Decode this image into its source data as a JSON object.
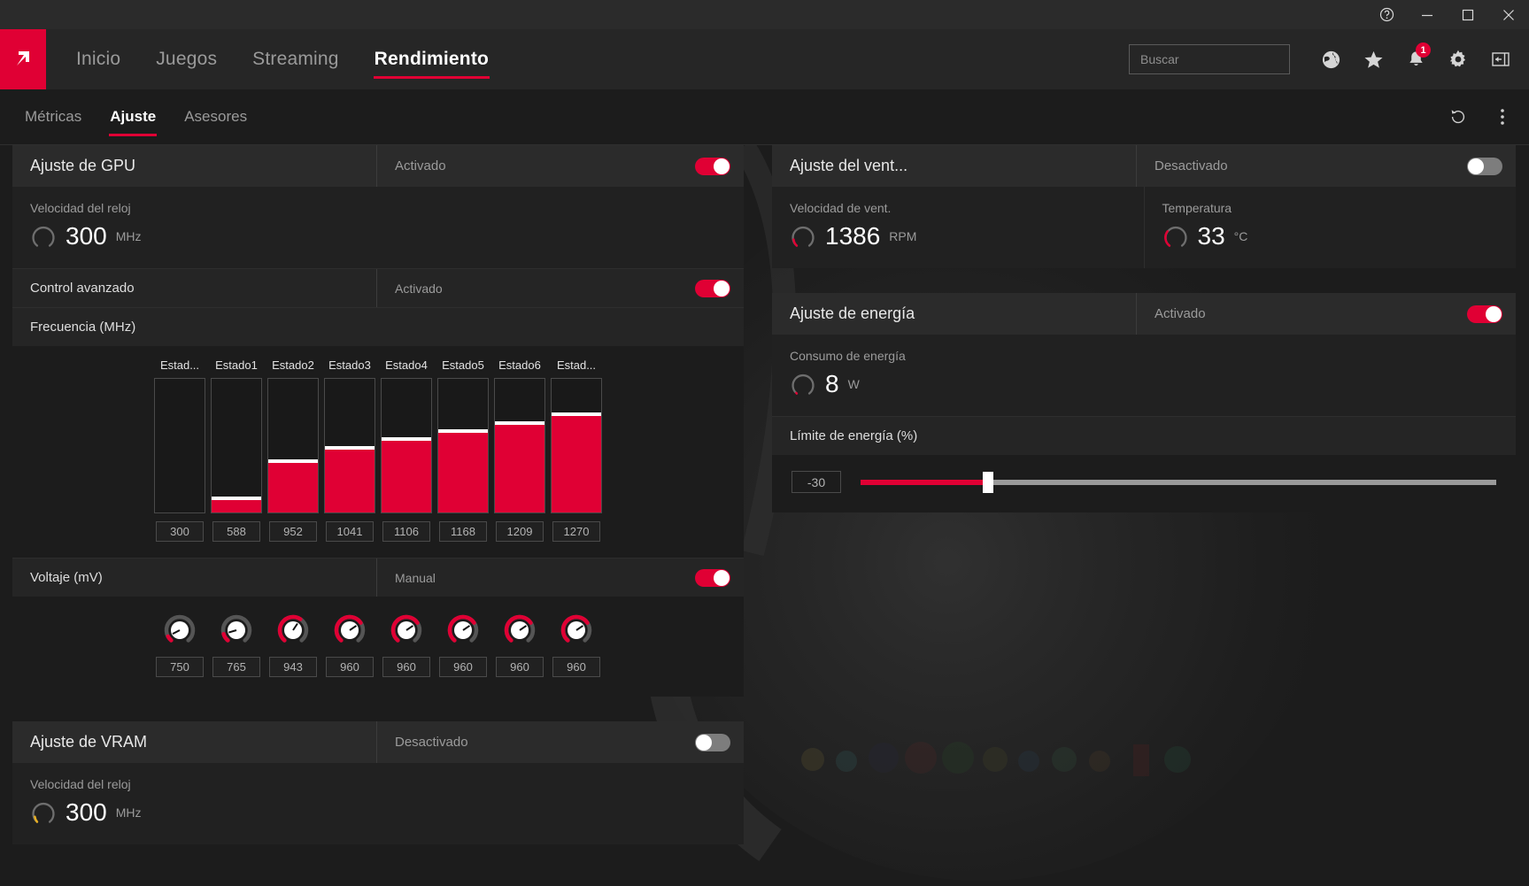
{
  "titlebar": {
    "help_label": "?",
    "minimize_label": "—",
    "maximize_label": "□",
    "close_label": "✕"
  },
  "nav": {
    "logo_name": "amd-radeon-logo",
    "items": [
      {
        "label": "Inicio",
        "active": false
      },
      {
        "label": "Juegos",
        "active": false
      },
      {
        "label": "Streaming",
        "active": false
      },
      {
        "label": "Rendimiento",
        "active": true
      }
    ],
    "search": {
      "placeholder": "Buscar",
      "value": ""
    },
    "notification_count": "1"
  },
  "subtabs": [
    {
      "label": "Métricas",
      "active": false
    },
    {
      "label": "Ajuste",
      "active": true
    },
    {
      "label": "Asesores",
      "active": false
    }
  ],
  "gpu_tuning": {
    "title": "Ajuste de GPU",
    "state": "Activado",
    "enabled": true,
    "clock_label": "Velocidad del reloj",
    "clock_value": "300",
    "clock_unit": "MHz",
    "advanced": {
      "title": "Control avanzado",
      "state": "Activado",
      "enabled": true
    },
    "frequency": {
      "title": "Frecuencia (MHz)"
    },
    "voltage": {
      "title": "Voltaje (mV)",
      "state": "Manual",
      "enabled": true,
      "values": [
        "750",
        "765",
        "943",
        "960",
        "960",
        "960",
        "960",
        "960"
      ],
      "percents": [
        8,
        12,
        62,
        70,
        70,
        70,
        70,
        70
      ]
    }
  },
  "vram_tuning": {
    "title": "Ajuste de VRAM",
    "state": "Desactivado",
    "enabled": false,
    "clock_label": "Velocidad del reloj",
    "clock_value": "300",
    "clock_unit": "MHz"
  },
  "fan_tuning": {
    "title": "Ajuste del vent...",
    "state": "Desactivado",
    "enabled": false,
    "speed_label": "Velocidad de vent.",
    "speed_value": "1386",
    "speed_unit": "RPM",
    "temp_label": "Temperatura",
    "temp_value": "33",
    "temp_unit": "°C"
  },
  "power_tuning": {
    "title": "Ajuste de energía",
    "state": "Activado",
    "enabled": true,
    "consumption_label": "Consumo de energía",
    "consumption_value": "8",
    "consumption_unit": "W",
    "limit_label": "Límite de energía (%)",
    "limit_value": "-30",
    "limit_fill_percent": 20
  },
  "colors": {
    "accent": "#e00034",
    "panel": "#212121",
    "header": "#2b2b2b",
    "background": "#1c1c1c",
    "vram_gauge": "#e8b023"
  },
  "chart_data": {
    "type": "bar",
    "title": "Frecuencia (MHz)",
    "categories": [
      "Estad...",
      "Estado1",
      "Estado2",
      "Estado3",
      "Estado4",
      "Estado5",
      "Estado6",
      "Estad..."
    ],
    "values": [
      300,
      588,
      952,
      1041,
      1106,
      1168,
      1209,
      1270
    ],
    "bar_percents": [
      0,
      12,
      40,
      50,
      56,
      62,
      68,
      75
    ],
    "xlabel": "",
    "ylabel": "Frecuencia (MHz)",
    "ylim": [
      0,
      1700
    ],
    "grid": false,
    "legend": "none"
  }
}
